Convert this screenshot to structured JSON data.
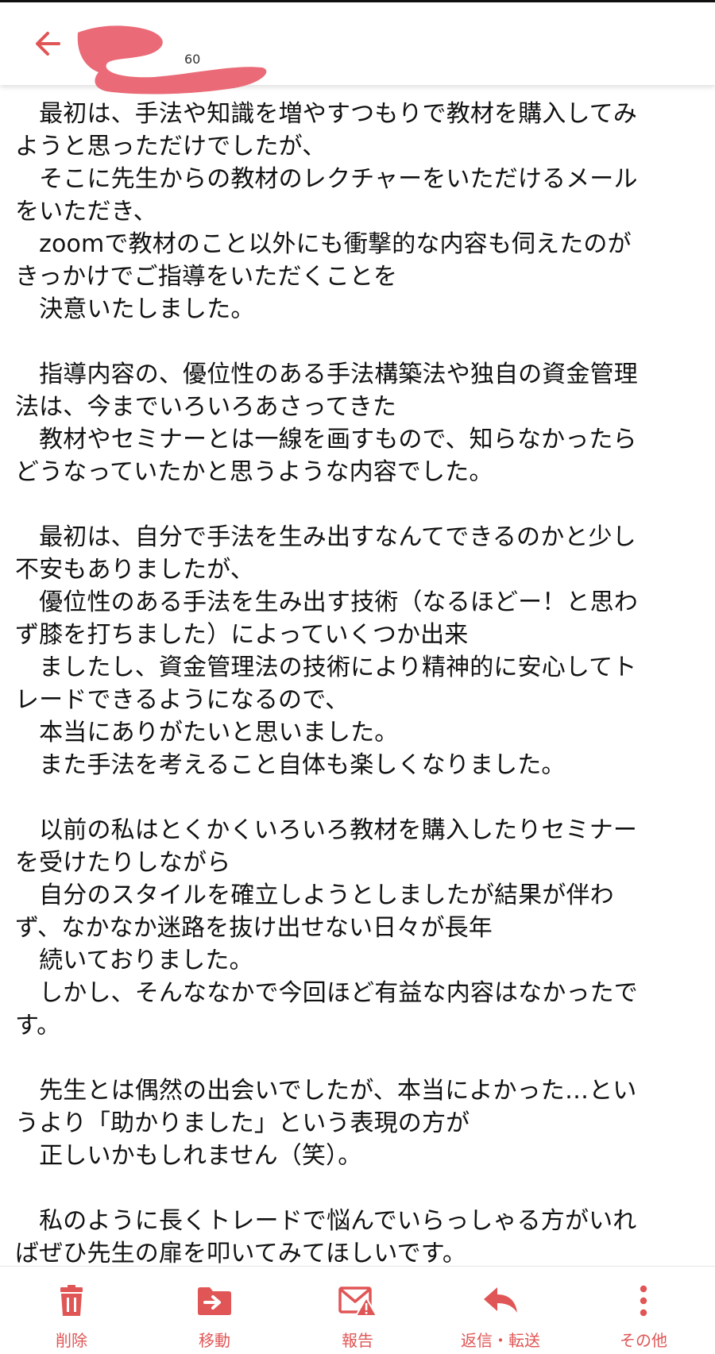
{
  "header": {
    "back_icon": "back-arrow-icon",
    "sender_fragment": "60",
    "redaction_color": "#ea6b77"
  },
  "email": {
    "lines": [
      "　最初は、手法や知識を増やすつもりで教材を購入してみ",
      "ようと思っただけでしたが、",
      "　そこに先生からの教材のレクチャーをいただけるメール",
      "をいただき、",
      "　zoomで教材のこと以外にも衝撃的な内容も伺えたのが",
      "きっかけでご指導をいただくことを",
      "　決意いたしました。",
      "",
      "　指導内容の、優位性のある手法構築法や独自の資金管理",
      "法は、今までいろいろあさってきた",
      "　教材やセミナーとは一線を画すもので、知らなかったら",
      "どうなっていたかと思うような内容でした。",
      "",
      "　最初は、自分で手法を生み出すなんてできるのかと少し",
      "不安もありましたが、",
      "　優位性のある手法を生み出す技術（なるほどー！と思わ",
      "ず膝を打ちました）によっていくつか出来",
      "　ましたし、資金管理法の技術により精神的に安心してト",
      "レードできるようになるので、",
      "　本当にありがたいと思いました。",
      "　また手法を考えること自体も楽しくなりました。",
      "",
      "　以前の私はとくかくいろいろ教材を購入したりセミナー",
      "を受けたりしながら",
      "　自分のスタイルを確立しようとしましたが結果が伴わ",
      "ず、なかなか迷路を抜け出せない日々が長年",
      "　続いておりました。",
      "　しかし、そんななかで今回ほど有益な内容はなかったで",
      "す。",
      "",
      "　先生とは偶然の出会いでしたが、本当によかった…とい",
      "うより「助かりました」という表現の方が",
      "　正しいかもしれません（笑）。",
      "",
      "　私のように長くトレードで悩んでいらっしゃる方がいれ",
      "ばぜひ先生の扉を叩いてみてほしいです。"
    ]
  },
  "toolbar": {
    "accent_color": "#e05555",
    "items": [
      {
        "label": "削除",
        "icon": "trash-icon"
      },
      {
        "label": "移動",
        "icon": "move-folder-icon"
      },
      {
        "label": "報告",
        "icon": "report-mail-icon"
      },
      {
        "label": "返信・転送",
        "icon": "reply-icon"
      },
      {
        "label": "その他",
        "icon": "more-vertical-icon"
      }
    ]
  }
}
